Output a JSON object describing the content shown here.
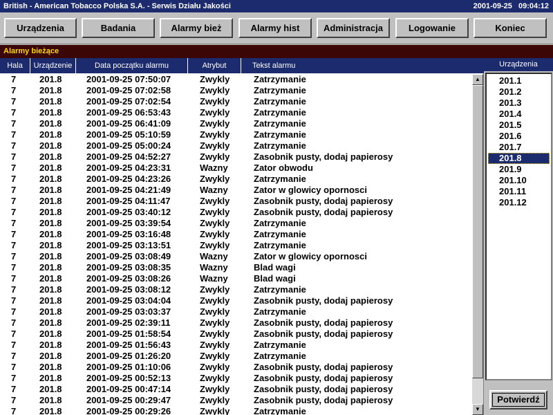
{
  "window": {
    "title": "British - American Tobacco Polska S.A. - Serwis Działu Jakości",
    "date": "2001-09-25",
    "time": "09:04:12"
  },
  "toolbar": {
    "buttons": [
      "Urządzenia",
      "Badania",
      "Alarmy bież",
      "Alarmy hist",
      "Administracja",
      "Logowanie",
      "Koniec"
    ]
  },
  "panel": {
    "title": "Alarmy bieżące"
  },
  "table": {
    "columns": [
      "Hala",
      "Urządzenie",
      "Data początku alarmu",
      "Atrybut",
      "Tekst alarmu"
    ],
    "rows": [
      [
        "7",
        "201.8",
        "2001-09-25 07:50:07",
        "Zwykly",
        "Zatrzymanie"
      ],
      [
        "7",
        "201.8",
        "2001-09-25 07:02:58",
        "Zwykly",
        "Zatrzymanie"
      ],
      [
        "7",
        "201.8",
        "2001-09-25 07:02:54",
        "Zwykly",
        "Zatrzymanie"
      ],
      [
        "7",
        "201.8",
        "2001-09-25 06:53:43",
        "Zwykly",
        "Zatrzymanie"
      ],
      [
        "7",
        "201.8",
        "2001-09-25 06:41:09",
        "Zwykly",
        "Zatrzymanie"
      ],
      [
        "7",
        "201.8",
        "2001-09-25 05:10:59",
        "Zwykly",
        "Zatrzymanie"
      ],
      [
        "7",
        "201.8",
        "2001-09-25 05:00:24",
        "Zwykly",
        "Zatrzymanie"
      ],
      [
        "7",
        "201.8",
        "2001-09-25 04:52:27",
        "Zwykly",
        "Zasobnik pusty, dodaj papierosy"
      ],
      [
        "7",
        "201.8",
        "2001-09-25 04:23:31",
        "Wazny",
        "Zator obwodu"
      ],
      [
        "7",
        "201.8",
        "2001-09-25 04:23:26",
        "Zwykly",
        "Zatrzymanie"
      ],
      [
        "7",
        "201.8",
        "2001-09-25 04:21:49",
        "Wazny",
        "Zator w glowicy opornosci"
      ],
      [
        "7",
        "201.8",
        "2001-09-25 04:11:47",
        "Zwykly",
        "Zasobnik pusty, dodaj papierosy"
      ],
      [
        "7",
        "201.8",
        "2001-09-25 03:40:12",
        "Zwykly",
        "Zasobnik pusty, dodaj papierosy"
      ],
      [
        "7",
        "201.8",
        "2001-09-25 03:39:54",
        "Zwykly",
        "Zatrzymanie"
      ],
      [
        "7",
        "201.8",
        "2001-09-25 03:16:48",
        "Zwykly",
        "Zatrzymanie"
      ],
      [
        "7",
        "201.8",
        "2001-09-25 03:13:51",
        "Zwykly",
        "Zatrzymanie"
      ],
      [
        "7",
        "201.8",
        "2001-09-25 03:08:49",
        "Wazny",
        "Zator w glowicy opornosci"
      ],
      [
        "7",
        "201.8",
        "2001-09-25 03:08:35",
        "Wazny",
        "Blad wagi"
      ],
      [
        "7",
        "201.8",
        "2001-09-25 03:08:26",
        "Wazny",
        "Blad wagi"
      ],
      [
        "7",
        "201.8",
        "2001-09-25 03:08:12",
        "Zwykly",
        "Zatrzymanie"
      ],
      [
        "7",
        "201.8",
        "2001-09-25 03:04:04",
        "Zwykly",
        "Zasobnik pusty, dodaj papierosy"
      ],
      [
        "7",
        "201.8",
        "2001-09-25 03:03:37",
        "Zwykly",
        "Zatrzymanie"
      ],
      [
        "7",
        "201.8",
        "2001-09-25 02:39:11",
        "Zwykly",
        "Zasobnik pusty, dodaj papierosy"
      ],
      [
        "7",
        "201.8",
        "2001-09-25 01:58:54",
        "Zwykly",
        "Zasobnik pusty, dodaj papierosy"
      ],
      [
        "7",
        "201.8",
        "2001-09-25 01:56:43",
        "Zwykly",
        "Zatrzymanie"
      ],
      [
        "7",
        "201.8",
        "2001-09-25 01:26:20",
        "Zwykly",
        "Zatrzymanie"
      ],
      [
        "7",
        "201.8",
        "2001-09-25 01:10:06",
        "Zwykly",
        "Zasobnik pusty, dodaj papierosy"
      ],
      [
        "7",
        "201.8",
        "2001-09-25 00:52:13",
        "Zwykly",
        "Zasobnik pusty, dodaj papierosy"
      ],
      [
        "7",
        "201.8",
        "2001-09-25 00:47:14",
        "Zwykly",
        "Zasobnik pusty, dodaj papierosy"
      ],
      [
        "7",
        "201.8",
        "2001-09-25 00:29:47",
        "Zwykly",
        "Zasobnik pusty, dodaj papierosy"
      ],
      [
        "7",
        "201.8",
        "2001-09-25 00:29:26",
        "Zwykly",
        "Zatrzymanie"
      ]
    ]
  },
  "devices": {
    "header": "Urządzenia",
    "items": [
      "201.1",
      "201.2",
      "201.3",
      "201.4",
      "201.5",
      "201.6",
      "201.7",
      "201.8",
      "201.9",
      "201.10",
      "201.11",
      "201.12"
    ],
    "selected": "201.8"
  },
  "actions": {
    "confirm_label": "Potwierdź"
  },
  "scrollbar": {
    "up_icon": "▲",
    "down_icon": "▼"
  },
  "colors": {
    "title_bar": "#1c2a6e",
    "panel_header_bg": "#3a0606",
    "panel_header_text": "#ffd800",
    "selection": "#1c2a6e"
  }
}
